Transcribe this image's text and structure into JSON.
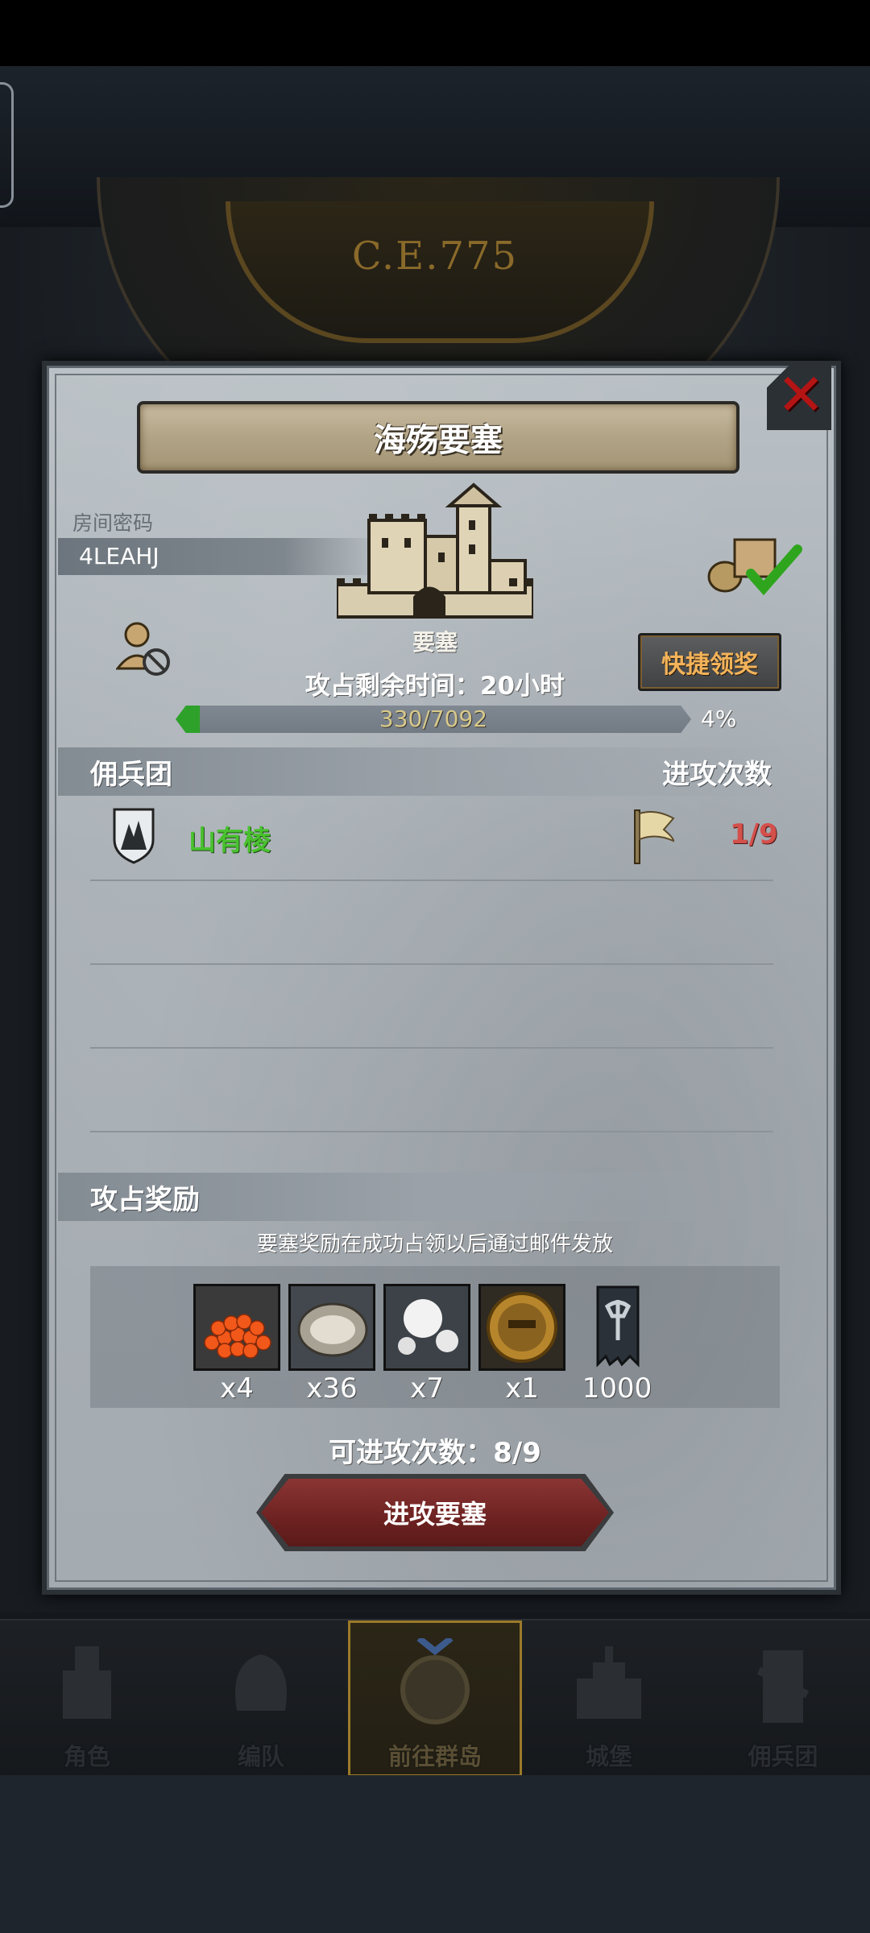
{
  "header": {
    "era_label": "C.E.775"
  },
  "panel": {
    "title": "海殇要塞",
    "room_password_label": "房间密码",
    "room_code": "4LEAHJ",
    "building_label": "要塞",
    "quick_claim_label": "快捷领奖",
    "remaining_time": "攻占剩余时间：20小时",
    "progress": {
      "text": "330/7092",
      "percent_text": "4%",
      "fraction": 0.0465
    },
    "mercenary_header": "佣兵团",
    "attack_count_header": "进攻次数",
    "mercenaries": [
      {
        "name": "山有棱",
        "attacks": "1/9"
      }
    ],
    "reward_header": "攻占奖励",
    "reward_note": "要塞奖励在成功占领以后通过邮件发放",
    "rewards": [
      {
        "icon": "roe-icon",
        "qty": "x4"
      },
      {
        "icon": "oyster-icon",
        "qty": "x36"
      },
      {
        "icon": "pearl-icon",
        "qty": "x7"
      },
      {
        "icon": "knight-medal-icon",
        "qty": "x1"
      },
      {
        "icon": "banner-icon",
        "qty": "1000"
      }
    ],
    "attempts_text": "可进攻次数：8/9",
    "attack_button": "进攻要塞"
  },
  "nav": [
    {
      "label": "角色",
      "icon": "knight-icon"
    },
    {
      "label": "编队",
      "icon": "helmet-icon"
    },
    {
      "label": "前往群岛",
      "icon": "globe-icon",
      "active": true
    },
    {
      "label": "城堡",
      "icon": "castle-icon"
    },
    {
      "label": "佣兵团",
      "icon": "mercenary-icon"
    }
  ],
  "colors": {
    "mercenary_name": "#49c12f",
    "attack_count": "#d4504b",
    "quick_claim_text": "#f3b35a",
    "progress_fill": "#2ea12a"
  }
}
